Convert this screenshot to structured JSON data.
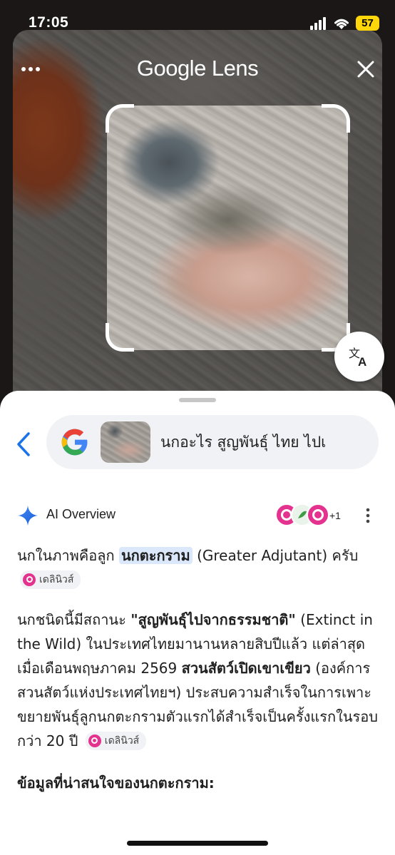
{
  "status": {
    "time": "17:05",
    "battery": "57"
  },
  "lens": {
    "title": "Google Lens"
  },
  "search": {
    "query": "นกอะไร สูญพันธุ์ ไทย ไปเ"
  },
  "ai_overview": {
    "label": "AI Overview",
    "sources_more": "+1"
  },
  "answer": {
    "p1": {
      "t1": "นกในภาพคือลูก",
      "highlight": "นกตะกราม",
      "t2": " (Greater Adjutant) ครับ",
      "chip": "เดลินิวส์"
    },
    "p2": {
      "t1": "นกชนิดนี้มีสถานะ ",
      "b1": "\"สูญพันธุ์ไปจากธรรมชาติ\"",
      "t2": " (Extinct in the Wild) ในประเทศไทยมานานหลายสิบปีแล้ว แต่ล่าสุดเมื่อเดือนพฤษภาคม 2569 ",
      "b2": "สวนสัตว์เปิดเขาเขียว",
      "t3": " (องค์การสวนสัตว์แห่งประเทศไทยฯ) ประสบความสำเร็จในการเพาะขยายพันธุ์ลูกนกตะกรามตัวแรกได้สำเร็จเป็นครั้งแรกในรอบกว่า 20 ปี",
      "chip": "เดลินิวส์"
    },
    "heading": "ข้อมูลที่น่าสนใจของนกตะกราม:"
  },
  "colors": {
    "accent": "#0b57d0",
    "source_pink": "#e3338f",
    "battery": "#ffd60a"
  },
  "icons": [
    "more-icon",
    "close-icon",
    "translate-icon",
    "back-chevron-icon",
    "google-g-icon",
    "sparkle-icon",
    "kebab-icon",
    "signal-icon",
    "wifi-icon"
  ]
}
